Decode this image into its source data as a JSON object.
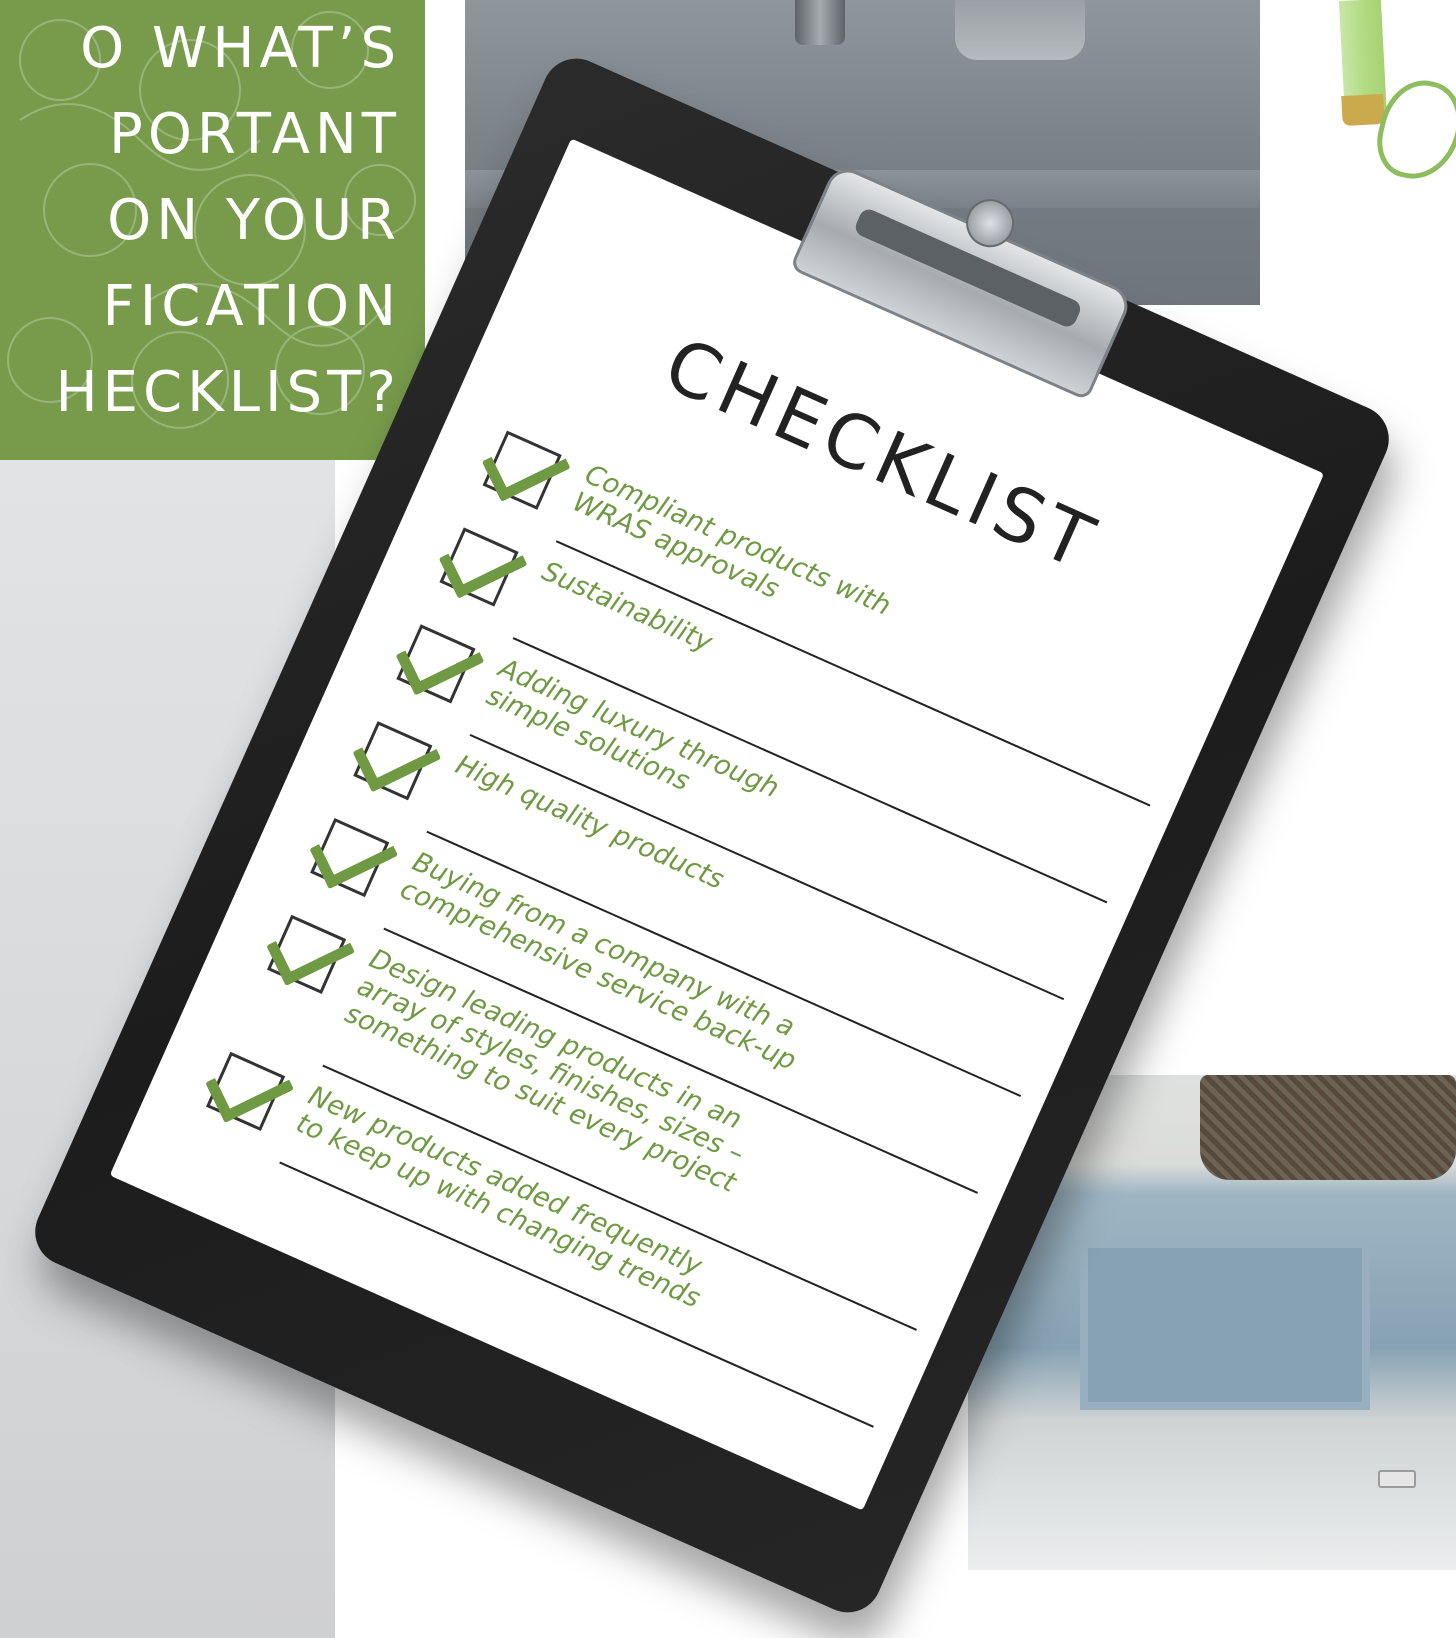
{
  "header": {
    "lines": [
      "O WHAT’S",
      "PORTANT",
      "ON YOUR",
      "FICATION",
      "HECKLIST?"
    ]
  },
  "checklist": {
    "title": "CHECKLIST",
    "items": [
      {
        "text": "Compliant products with\nWRAS approvals",
        "checked": true
      },
      {
        "text": "Sustainability",
        "checked": true
      },
      {
        "text": "Adding luxury through\nsimple solutions",
        "checked": true
      },
      {
        "text": "High quality products",
        "checked": true
      },
      {
        "text": "Buying from a company with a\ncomprehensive service back-up",
        "checked": true
      },
      {
        "text": "Design leading products in an\narray of styles, finishes, sizes –\nsomething to suit every project",
        "checked": true
      },
      {
        "text": "New products added frequently\nto keep up with changing trends",
        "checked": true
      }
    ]
  },
  "colors": {
    "brand_green": "#779b4b",
    "handwriting_green": "#6f9a43",
    "clipboard_black": "#222222"
  }
}
